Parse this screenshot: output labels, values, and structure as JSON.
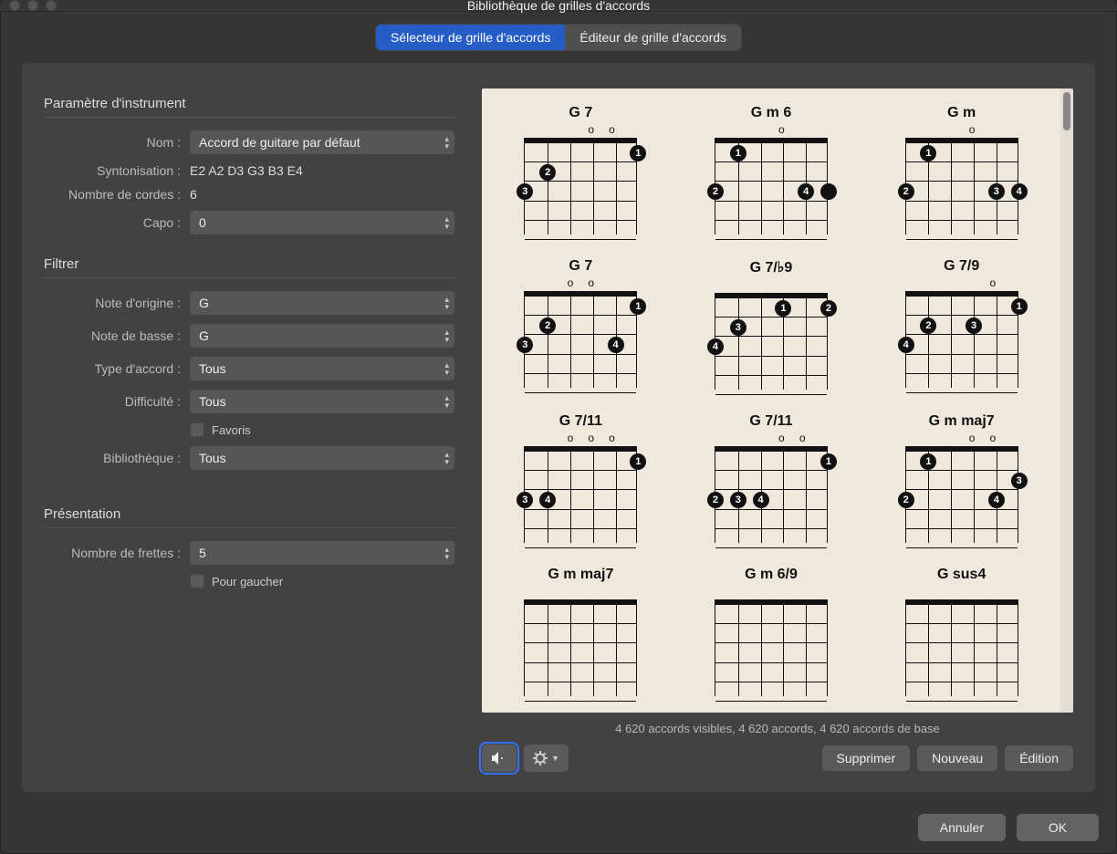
{
  "window": {
    "title": "Bibliothèque de grilles d'accords"
  },
  "tabs": {
    "selector": "Sélecteur de grille d'accords",
    "editor": "Éditeur de grille d'accords"
  },
  "sections": {
    "instrument": "Paramètre d'instrument",
    "filter": "Filtrer",
    "view": "Présentation"
  },
  "labels": {
    "name": "Nom :",
    "tuning": "Syntonisation :",
    "strings": "Nombre de cordes :",
    "capo": "Capo :",
    "root": "Note d'origine :",
    "bass": "Note de basse :",
    "chordtype": "Type d'accord :",
    "difficulty": "Difficulté :",
    "favorites": "Favoris",
    "library": "Bibliothèque :",
    "frets": "Nombre de frettes :",
    "lefthand": "Pour gaucher"
  },
  "values": {
    "name": "Accord de guitare par défaut",
    "tuning": "E2 A2 D3 G3 B3 E4",
    "strings": "6",
    "capo": "0",
    "root": "G",
    "bass": "G",
    "chordtype": "Tous",
    "difficulty": "Tous",
    "library": "Tous",
    "frets": "5"
  },
  "status": "4 620 accords visibles, 4 620 accords, 4 620 accords de base",
  "buttons": {
    "delete": "Supprimer",
    "new": "Nouveau",
    "edit": "Édition",
    "cancel": "Annuler",
    "ok": "OK"
  },
  "chords": [
    {
      "name": "G 7",
      "open": [
        "",
        "",
        "",
        "o",
        "o",
        ""
      ],
      "dots": [
        {
          "s": 5,
          "f": 1,
          "n": "1"
        },
        {
          "s": 1,
          "f": 2,
          "n": "2"
        },
        {
          "s": 0,
          "f": 3,
          "n": "3"
        }
      ]
    },
    {
      "name": "G m 6",
      "open": [
        "",
        "",
        "",
        "o",
        "",
        ""
      ],
      "dots": [
        {
          "s": 1,
          "f": 1,
          "n": "1"
        },
        {
          "s": 0,
          "f": 3,
          "n": "2"
        },
        {
          "s": 4,
          "f": 3,
          "n": "4"
        },
        {
          "s": 5,
          "f": 3,
          "n": ""
        }
      ]
    },
    {
      "name": "G m",
      "open": [
        "",
        "",
        "",
        "o",
        "",
        ""
      ],
      "dots": [
        {
          "s": 1,
          "f": 1,
          "n": "1"
        },
        {
          "s": 0,
          "f": 3,
          "n": "2"
        },
        {
          "s": 4,
          "f": 3,
          "n": "3"
        },
        {
          "s": 5,
          "f": 3,
          "n": "4"
        }
      ]
    },
    {
      "name": "G 7",
      "open": [
        "",
        "",
        "o",
        "o",
        "",
        ""
      ],
      "dots": [
        {
          "s": 5,
          "f": 1,
          "n": "1"
        },
        {
          "s": 1,
          "f": 2,
          "n": "2"
        },
        {
          "s": 0,
          "f": 3,
          "n": "3"
        },
        {
          "s": 4,
          "f": 3,
          "n": "4"
        }
      ]
    },
    {
      "name": "G 7/♭9",
      "open": [
        "",
        "",
        "",
        "",
        "",
        ""
      ],
      "dots": [
        {
          "s": 3,
          "f": 1,
          "n": "1"
        },
        {
          "s": 5,
          "f": 1,
          "n": "2"
        },
        {
          "s": 1,
          "f": 2,
          "n": "3"
        },
        {
          "s": 0,
          "f": 3,
          "n": "4"
        }
      ]
    },
    {
      "name": "G 7/9",
      "open": [
        "",
        "",
        "",
        "",
        "o",
        ""
      ],
      "dots": [
        {
          "s": 5,
          "f": 1,
          "n": "1"
        },
        {
          "s": 1,
          "f": 2,
          "n": "2"
        },
        {
          "s": 3,
          "f": 2,
          "n": "3"
        },
        {
          "s": 0,
          "f": 3,
          "n": "4"
        }
      ]
    },
    {
      "name": "G 7/11",
      "open": [
        "",
        "",
        "o",
        "o",
        "o",
        ""
      ],
      "dots": [
        {
          "s": 5,
          "f": 1,
          "n": "1"
        },
        {
          "s": 0,
          "f": 3,
          "n": "3"
        },
        {
          "s": 1,
          "f": 3,
          "n": "4"
        }
      ]
    },
    {
      "name": "G 7/11",
      "open": [
        "",
        "",
        "",
        "o",
        "o",
        ""
      ],
      "dots": [
        {
          "s": 5,
          "f": 1,
          "n": "1"
        },
        {
          "s": 0,
          "f": 3,
          "n": "2"
        },
        {
          "s": 1,
          "f": 3,
          "n": "3"
        },
        {
          "s": 2,
          "f": 3,
          "n": "4"
        }
      ]
    },
    {
      "name": "G m maj7",
      "open": [
        "",
        "",
        "",
        "o",
        "o",
        ""
      ],
      "dots": [
        {
          "s": 1,
          "f": 1,
          "n": "1"
        },
        {
          "s": 5,
          "f": 2,
          "n": "3"
        },
        {
          "s": 0,
          "f": 3,
          "n": "2"
        },
        {
          "s": 4,
          "f": 3,
          "n": "4"
        }
      ]
    },
    {
      "name": "G m maj7",
      "open": [
        "",
        "",
        "",
        "",
        "",
        ""
      ],
      "dots": []
    },
    {
      "name": "G m 6/9",
      "open": [
        "",
        "",
        "",
        "",
        "",
        ""
      ],
      "dots": []
    },
    {
      "name": "G sus4",
      "open": [
        "",
        "",
        "",
        "",
        "",
        ""
      ],
      "dots": []
    }
  ]
}
